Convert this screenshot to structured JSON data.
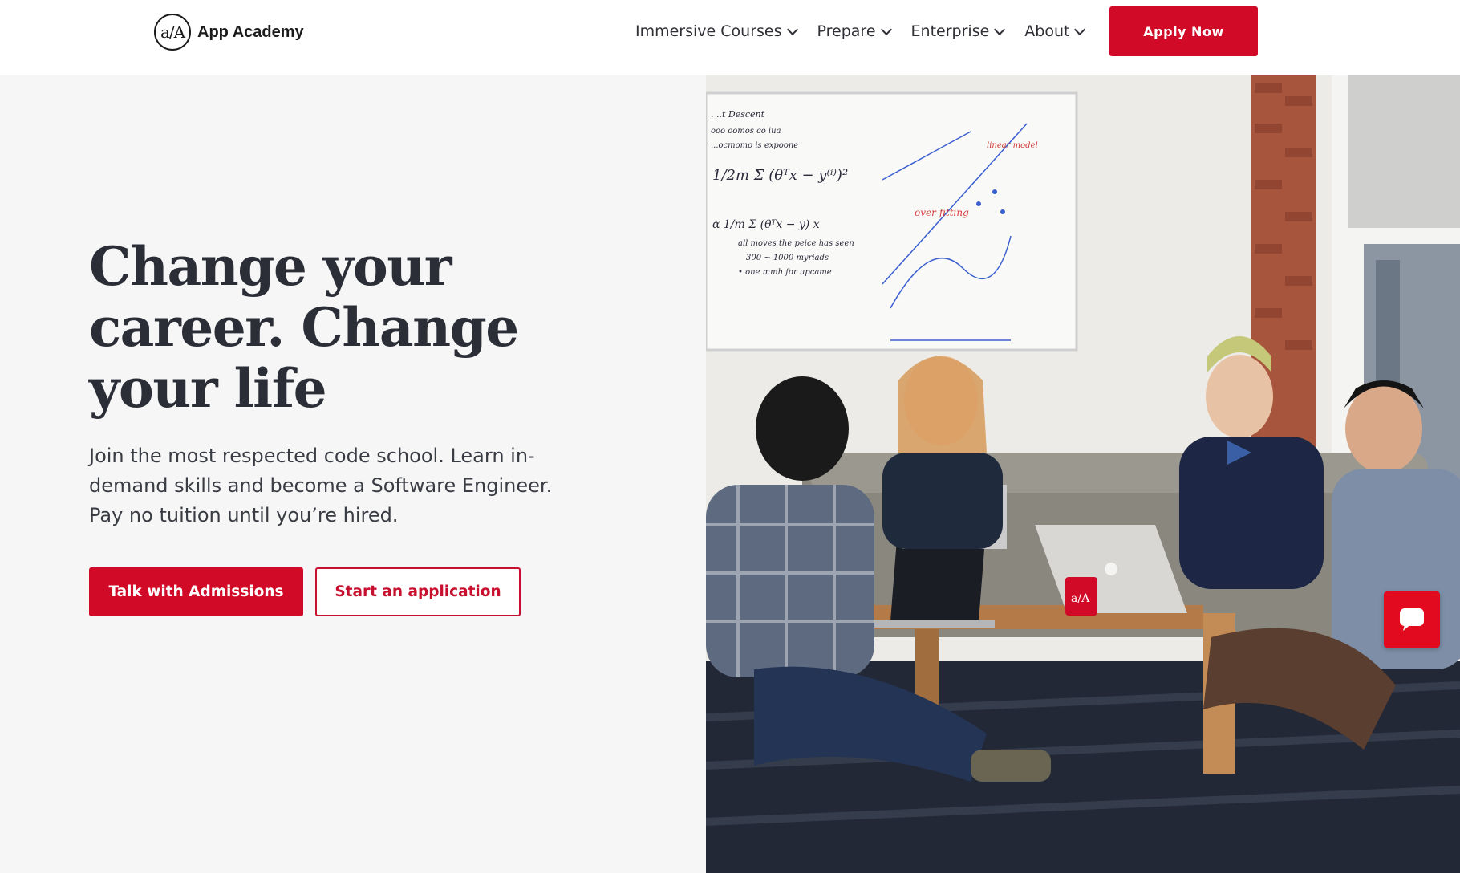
{
  "header": {
    "logo_mark": "a/A",
    "logo_text": "App Academy",
    "nav": [
      {
        "label": "Immersive Courses"
      },
      {
        "label": "Prepare"
      },
      {
        "label": "Enterprise"
      },
      {
        "label": "About"
      }
    ],
    "apply_label": "Apply Now"
  },
  "hero": {
    "headline": "Change your career. Change your life",
    "subtext": "Join the most respected code school. Learn in-demand skills and become a Software Engineer. Pay no tuition until you’re hired.",
    "primary_cta": "Talk with Admissions",
    "secondary_cta": "Start an application",
    "image_alt": "students collaborating around laptops",
    "mug_label": "a/A"
  },
  "chat": {
    "icon": "chat-bubble-icon"
  },
  "colors": {
    "brand_red": "#d10a27",
    "text_dark": "#2c2e37",
    "panel_bg": "#f6f6f6"
  }
}
